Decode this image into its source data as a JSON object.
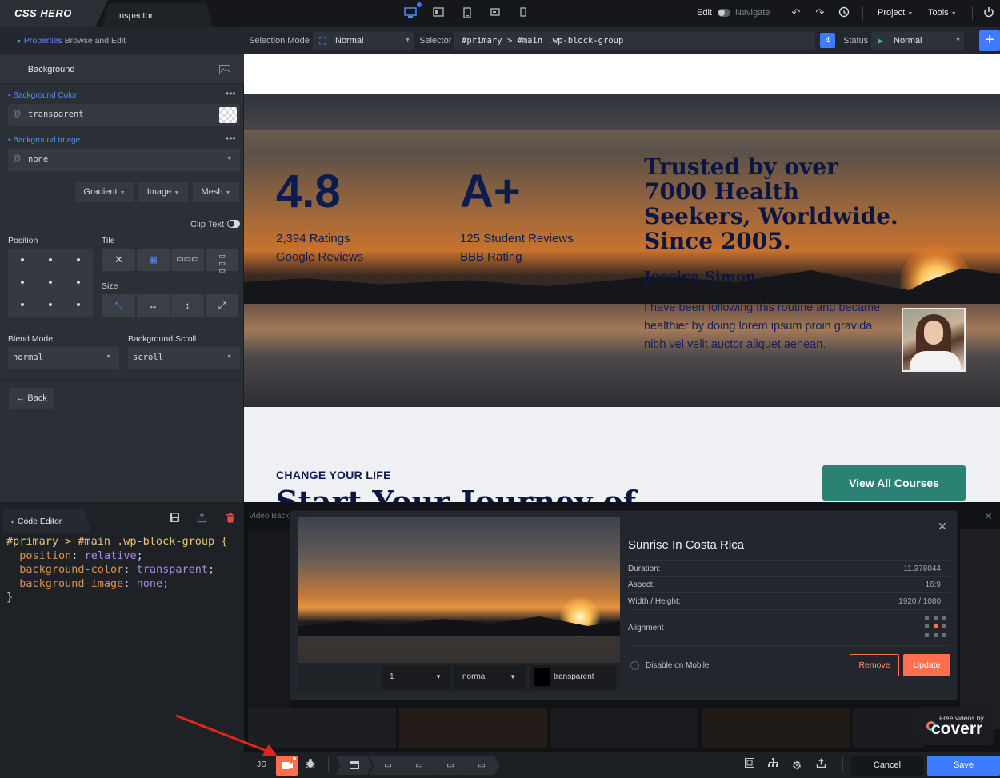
{
  "app": {
    "logo": "CSS HERO",
    "tab": "Inspector"
  },
  "topbar": {
    "edit_label": "Edit",
    "navigate_label": "Navigate",
    "project_label": "Project",
    "tools_label": "Tools"
  },
  "toolbar2": {
    "selection_mode_label": "Selection Mode",
    "selection_mode_value": "Normal",
    "selector_label": "Selector",
    "selector_value": "#primary > #main .wp-block-group",
    "count": "4",
    "status_label": "Status",
    "status_value": "Normal"
  },
  "left": {
    "properties_label": "Properties",
    "browse_edit_label": "Browse and Edit",
    "section_title": "Background",
    "bg_color_label": "Background Color",
    "bg_color_value": "transparent",
    "bg_image_label": "Background Image",
    "bg_image_value": "none",
    "gradient_btn": "Gradient",
    "image_btn": "Image",
    "mesh_btn": "Mesh",
    "clip_text_label": "Clip Text",
    "position_label": "Position",
    "tile_label": "Tile",
    "size_label": "Size",
    "blend_mode_label": "Blend Mode",
    "blend_mode_value": "normal",
    "bg_scroll_label": "Background Scroll",
    "bg_scroll_value": "scroll",
    "back_btn": "← Back"
  },
  "preview": {
    "stat1_value": "4.8",
    "stat1_line1": "2,394 Ratings",
    "stat1_line2": "Google Reviews",
    "stat2_value": "A+",
    "stat2_line1": "125 Student Reviews",
    "stat2_line2": "BBB Rating",
    "quote_title": "Trusted by over 7000 Health Seekers, Worldwide. Since 2005.",
    "quote_name": "Jessica Simon",
    "quote_text": "I have been following this routine and became healthier by doing lorem ipsum proin gravida nibh vel velit auctor aliquet aenean.",
    "change_label": "CHANGE YOUR LIFE",
    "journey_heading": "Start Your Journey of",
    "courses_btn": "View All Courses"
  },
  "code_editor": {
    "title": "Code Editor",
    "selector": "#primary > #main .wp-block-group {",
    "lines": [
      {
        "prop": "position",
        "value": "relative"
      },
      {
        "prop": "background-color",
        "value": "transparent"
      },
      {
        "prop": "background-image",
        "value": "none"
      }
    ],
    "close": "}"
  },
  "video_modal": {
    "bg_title": "Video Back",
    "title": "Sunrise In Costa Rica",
    "duration_label": "Duration:",
    "duration_value": "11.378044",
    "aspect_label": "Aspect:",
    "aspect_value": "16:9",
    "wh_label": "Width / Height:",
    "wh_value": "1920 / 1080",
    "alignment_label": "Alignment",
    "disable_mobile_label": "Disable on Mobile",
    "remove_btn": "Remove",
    "update_btn": "Update",
    "ctrl_speed": "1",
    "ctrl_blend": "normal",
    "ctrl_color": "transparent",
    "coverr_small": "Free videos by",
    "coverr_logo": "coverr"
  },
  "bottombar": {
    "js_label": "JS",
    "cancel_btn": "Cancel",
    "save_btn": "Save"
  },
  "colors": {
    "accent": "#3d7bff",
    "orange": "#ff6f4d",
    "teal": "#2b8173",
    "navy": "#0d1c4e"
  }
}
